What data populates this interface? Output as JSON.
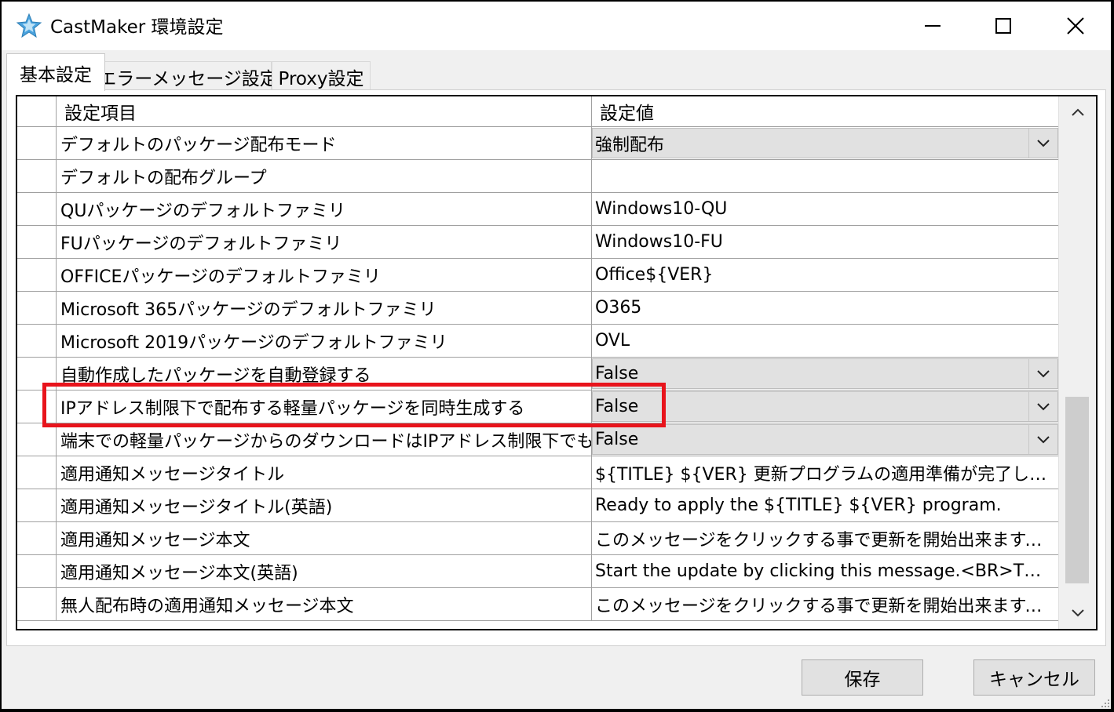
{
  "window": {
    "title": "CastMaker 環境設定"
  },
  "tabs": [
    {
      "label": "基本設定"
    },
    {
      "label": "エラーメッセージ設定"
    },
    {
      "label": "Proxy設定"
    }
  ],
  "grid": {
    "headers": [
      "設定項目",
      "設定値"
    ],
    "rows": [
      {
        "name": "デフォルトのパッケージ配布モード",
        "value": "強制配布"
      },
      {
        "name": "デフォルトの配布グループ",
        "value": ""
      },
      {
        "name": "QUパッケージのデフォルトファミリ",
        "value": "Windows10-QU"
      },
      {
        "name": "FUパッケージのデフォルトファミリ",
        "value": "Windows10-FU"
      },
      {
        "name": "OFFICEパッケージのデフォルトファミリ",
        "value": "Office${VER}"
      },
      {
        "name": "Microsoft 365パッケージのデフォルトファミリ",
        "value": "O365"
      },
      {
        "name": "Microsoft 2019パッケージのデフォルトファミリ",
        "value": "OVL"
      },
      {
        "name": "自動作成したパッケージを自動登録する",
        "value": "False"
      },
      {
        "name": "IPアドレス制限下で配布する軽量パッケージを同時生成する",
        "value": "False"
      },
      {
        "name": "端末での軽量パッケージからのダウンロードはIPアドレス制限下でも行う",
        "value": "False"
      },
      {
        "name": "適用通知メッセージタイトル",
        "value": "${TITLE} ${VER} 更新プログラムの適用準備が完了しました"
      },
      {
        "name": "適用通知メッセージタイトル(英語)",
        "value": "Ready to apply the ${TITLE} ${VER} program."
      },
      {
        "name": "適用通知メッセージ本文",
        "value": "このメッセージをクリックする事で更新を開始出来ます。<BR>..."
      },
      {
        "name": "適用通知メッセージ本文(英語)",
        "value": "Start the update by clicking this message.<BR>This up..."
      },
      {
        "name": "無人配布時の適用通知メッセージ本文",
        "value": "このメッセージをクリックする事で更新を開始出来ます。<BR>..."
      }
    ]
  },
  "buttons": {
    "save": "保存",
    "cancel": "キャンセル"
  },
  "colors": {
    "highlight": "#e8141c",
    "combo_bg": "#e1e1e1",
    "icon_blue": "#4aa3df"
  }
}
